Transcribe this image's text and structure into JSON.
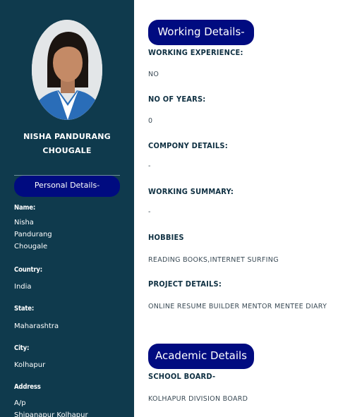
{
  "profile": {
    "name_line1": "NISHA PANDURANG",
    "name_line2": "CHOUGALE"
  },
  "sidebar": {
    "section_title": "Personal Details-",
    "fields": {
      "name_label": "Name:",
      "name_lines": [
        "Nisha",
        "Pandurang",
        "Chougale"
      ],
      "country_label": "Country:",
      "country_value": "India",
      "state_label": "State:",
      "state_value": "Maharashtra",
      "city_label": "City:",
      "city_value": "Kolhapur",
      "address_label": "Address",
      "address_lines": [
        "A/p",
        "Shipanapur Kolhapur"
      ]
    }
  },
  "working": {
    "section_title": "Working Details-",
    "experience_label": "WORKING EXPERIENCE:",
    "experience_value": "NO",
    "years_label": "NO OF YEARS:",
    "years_value": "0",
    "company_label": "COMPONY DETAILS:",
    "company_value": "-",
    "summary_label": "WORKING SUMMARY:",
    "summary_value": "-",
    "hobbies_label": "HOBBIES",
    "hobbies_value": "READING BOOKS,INTERNET SURFING",
    "project_label": "PROJECT DETAILS:",
    "project_value": "ONLINE RESUME BUILDER MENTOR MENTEE DIARY"
  },
  "academic": {
    "section_title": "Academic Details",
    "school_board_label": "SCHOOL BOARD-",
    "school_board_value": "KOLHAPUR DIVISION BOARD"
  },
  "colors": {
    "sidebar_bg": "#0f3a4d",
    "pill_bg": "#000b80",
    "heading_text": "#0f3042"
  }
}
